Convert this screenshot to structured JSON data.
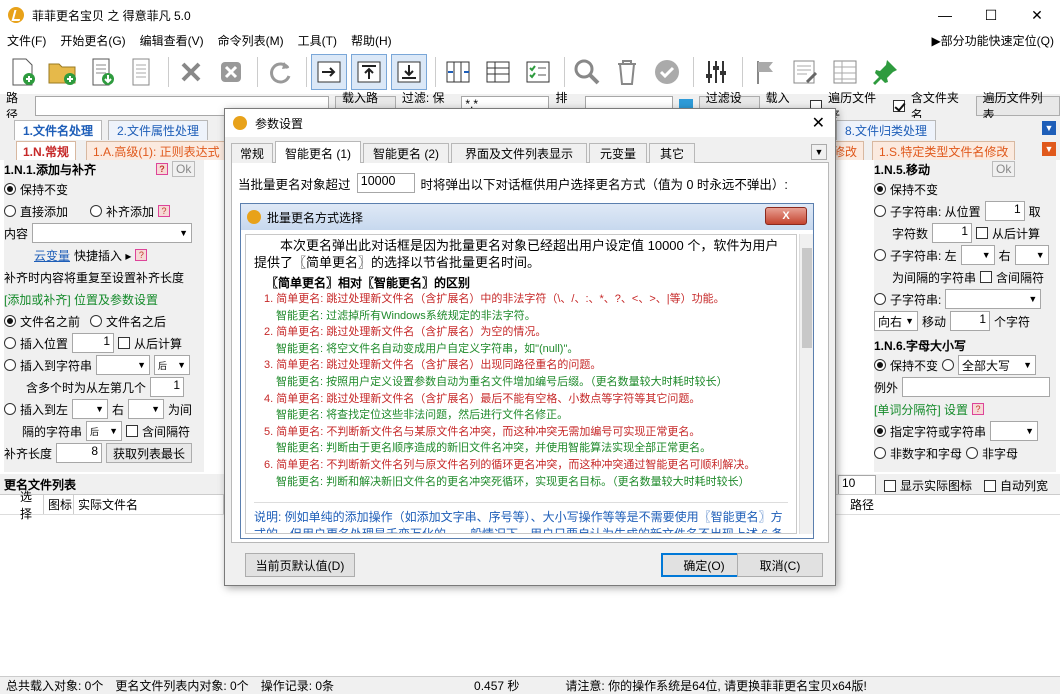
{
  "window": {
    "title": "菲菲更名宝贝 之 得意菲凡 5.0"
  },
  "menu": [
    "文件(F)",
    "开始更名(G)",
    "编辑查看(V)",
    "命令列表(M)",
    "工具(T)",
    "帮助(H)"
  ],
  "quick_position": "▶部分功能快速定位(Q)",
  "pathbar": {
    "path_label": "路径",
    "load_btn": "载入路径",
    "filter_label": "过滤: 保留",
    "filter_value": "*.*",
    "exclude_label": "排除",
    "filter_settings_btn": "过滤设置",
    "load_time_label": "载入时:",
    "traverse_label": "遍历文件夹",
    "include_folder_label": "含文件夹名",
    "traverse_list_btn": "遍历文件列表"
  },
  "tabs_row1": [
    {
      "label": "1.文件名处理",
      "active": true
    },
    {
      "label": "2.文件属性处理",
      "active": false
    },
    {
      "label": "8.文件归类处理",
      "active": false
    }
  ],
  "tabs_row2": [
    {
      "label": "1.N.常规"
    },
    {
      "label": "1.A.高级(1): 正则表达式"
    },
    {
      "label": "修改"
    },
    {
      "label": "1.S.特定类型文件名修改"
    }
  ],
  "left_panel": {
    "header": "1.N.1.添加与补齐",
    "opt_keep": "保持不变",
    "opt_direct_add": "直接添加",
    "opt_pad_add": "补齐添加",
    "content_label": "内容",
    "cloud_var": "云变量",
    "quick_insert": "快捷插入 ▸",
    "pad_note": "补齐时内容将重复至设置补齐长度",
    "pos_header": "[添加或补齐] 位置及参数设置",
    "before_name": "文件名之前",
    "after_name": "文件名之后",
    "insert_pos": "插入位置",
    "insert_pos_val": "1",
    "from_end": "从后计算",
    "insert_to_str": "插入到字符串",
    "back_label": "后",
    "multi_label": "含多个时为从左第几个",
    "multi_val": "1",
    "insert_left": "插入到左",
    "right_label": "右",
    "between_label": "为间",
    "gap_str": "隔的字符串",
    "contains_gap": "含间隔符",
    "pad_len_label": "补齐长度",
    "pad_len_val": "8",
    "get_longest_btn": "获取列表最长"
  },
  "right_panel": {
    "header": "1.N.5.移动",
    "opt_keep": "保持不变",
    "substr_label": "子字符串: 从位置",
    "substr_pos": "1",
    "take": "取",
    "char_count": "字符数",
    "char_count_val": "1",
    "from_end": "从后计算",
    "substr_left": "子字符串: 左",
    "right_label": "右",
    "gap_str": "为间隔的字符串",
    "contains_gap": "含间隔符",
    "substr2": "子字符串:",
    "dir_value": "向右",
    "move_label": "移动",
    "move_val": "1",
    "chars": "个字符",
    "case_header": "1.N.6.字母大小写",
    "case_keep": "保持不变",
    "case_upper": "全部大写",
    "except_label": "例外",
    "word_sep_header": "[单词分隔符] 设置",
    "specified": "指定字符或字符串",
    "non_alpha": "非数字和字母",
    "non_letter": "非字母",
    "ok_label": "Ok"
  },
  "list": {
    "header": "更名文件列表",
    "cols": [
      "选择",
      "图标",
      "实际文件名"
    ],
    "path_col": "路径",
    "count_val": "10",
    "show_icon": "显示实际图标",
    "auto_width": "自动列宽"
  },
  "status": {
    "total": "总共载入对象: 0个",
    "in_list": "更名文件列表内对象: 0个",
    "ops": "操作记录: 0条",
    "time": "0.457 秒",
    "notice": "请注意: 你的操作系统是64位, 请更换菲菲更名宝贝x64版!"
  },
  "dialog": {
    "title": "参数设置",
    "tabs": [
      "常规",
      "智能更名 (1)",
      "智能更名 (2)",
      "界面及文件列表显示",
      "元变量",
      "其它"
    ],
    "active_tab": 1,
    "threshold_prefix": "当批量更名对象超过",
    "threshold_value": "10000",
    "threshold_suffix": "时将弹出以下对话框供用户选择更名方式（值为 0 时永远不弹出）:",
    "reset_btn": "当前页默认值(D)",
    "ok_btn": "确定(O)",
    "cancel_btn": "取消(C)"
  },
  "inner_dialog": {
    "title": "批量更名方式选择",
    "close": "X",
    "intro": "本次更名弹出此对话框是因为批量更名对象已经超出用户设定值 10000 个，软件为用户提供了〖简单更名〗的选择以节省批量更名时间。",
    "section": "〖简单更名〗相对〖智能更名〗的区别",
    "points": [
      {
        "red": "1. 简单更名: 跳过处理新文件名（含扩展名）中的非法字符（\\、/、:、*、?、<、>、|等）功能。",
        "green": "智能更名: 过滤掉所有Windows系统规定的非法字符。"
      },
      {
        "red": "2. 简单更名: 跳过处理新文件名（含扩展名）为空的情况。",
        "green": "智能更名: 将空文件名自动变成用户自定义字符串，如\"(null)\"。"
      },
      {
        "red": "3. 简单更名: 跳过处理新文件名（含扩展名）出现同路径重名的问题。",
        "green": "智能更名: 按照用户定义设置参数自动为重名文件增加编号后缀。（更名数量较大时耗时较长）"
      },
      {
        "red": "4. 简单更名: 跳过处理新文件名（含扩展名）最后不能有空格、小数点等字符等其它问题。",
        "green": "智能更名: 将查找定位这些非法问题，然后进行文件名修正。"
      },
      {
        "red": "5. 简单更名: 不判断新文件名与某原文件名冲突，而这种冲突无需加编号可实现正常更名。",
        "green": "智能更名: 判断由于更名顺序造成的新旧文件名冲突，并使用智能算法实现全部正常更名。"
      },
      {
        "red": "6. 简单更名: 不判断新文件名列与原文件名列的循环更名冲突，而这种冲突通过智能更名可顺利解决。",
        "green": "智能更名: 判断和解决新旧文件名的更名冲突死循环，实现更名目标。（更名数量较大时耗时较长）"
      }
    ],
    "note": "说明: 例如单纯的添加操作（如添加文字串、序号等）、大小写操作等等是不需要使用〖智能更名〗方式的，但用户更名处理是千变万化的，一般情况下，用户只要自认为生成的新文件名不出现上述 6 条问题，就可以选择〖简单更名〗以节省处理时间，出现了上述问题仍选择〖简单更名〗方式时，将进行部分或全"
  }
}
